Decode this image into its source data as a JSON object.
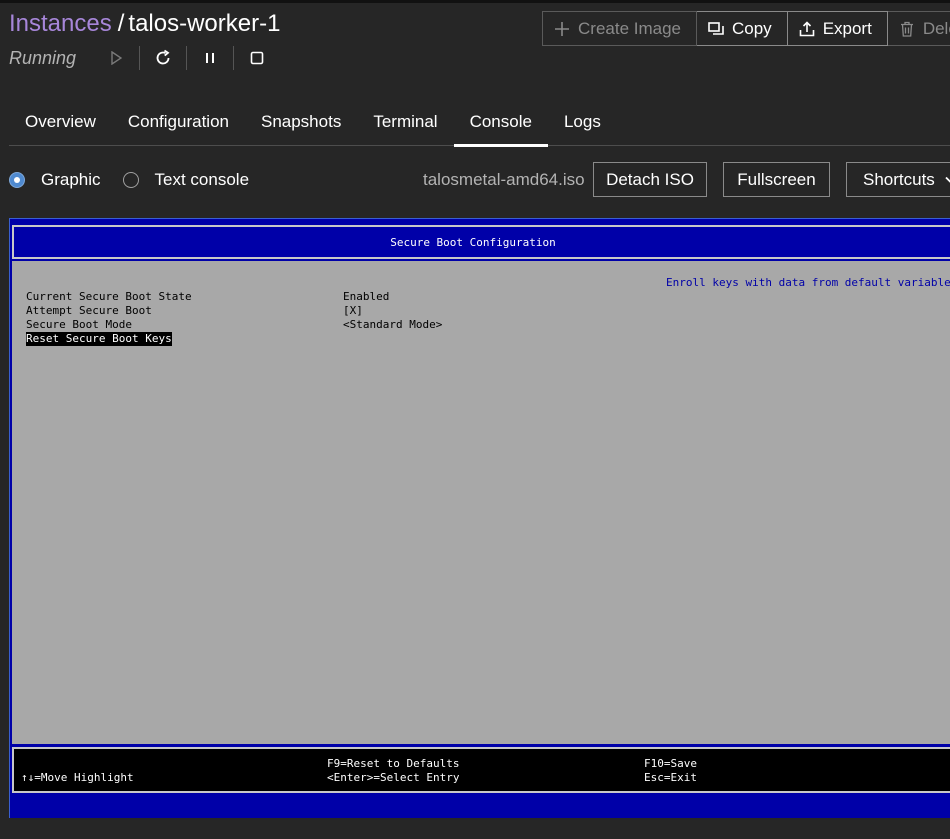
{
  "breadcrumb": {
    "parent": "Instances",
    "separator": "/",
    "current": "talos-worker-1"
  },
  "status": "Running",
  "actions": {
    "create_image": "Create Image",
    "copy": "Copy",
    "export": "Export",
    "delete": "Delete"
  },
  "tabs": [
    "Overview",
    "Configuration",
    "Snapshots",
    "Terminal",
    "Console",
    "Logs"
  ],
  "active_tab": "Console",
  "console": {
    "radio_graphic": "Graphic",
    "radio_text": "Text console",
    "selected_mode": "Graphic",
    "iso": "talosmetal-amd64.iso",
    "detach_iso": "Detach ISO",
    "fullscreen": "Fullscreen",
    "shortcuts": "Shortcuts"
  },
  "bios": {
    "title": "Secure Boot Configuration",
    "help_text": "Enroll keys with data from default variables",
    "rows": [
      {
        "label": "Current Secure Boot State",
        "value": "Enabled"
      },
      {
        "label": "Attempt Secure Boot",
        "value": "[X]"
      },
      {
        "label": "Secure Boot Mode",
        "value": "<Standard Mode>"
      },
      {
        "label": "Reset Secure Boot Keys",
        "value": ""
      }
    ],
    "footer": {
      "move": "↑↓=Move Highlight",
      "reset_defaults": "F9=Reset to Defaults",
      "select_entry": "<Enter>=Select Entry",
      "save": "F10=Save",
      "exit": "Esc=Exit"
    }
  },
  "colors": {
    "accent_link": "#a786d9",
    "bios_blue": "#0000a8",
    "bios_gray": "#a8a8a8",
    "radio_checked": "#4f8ad0"
  }
}
